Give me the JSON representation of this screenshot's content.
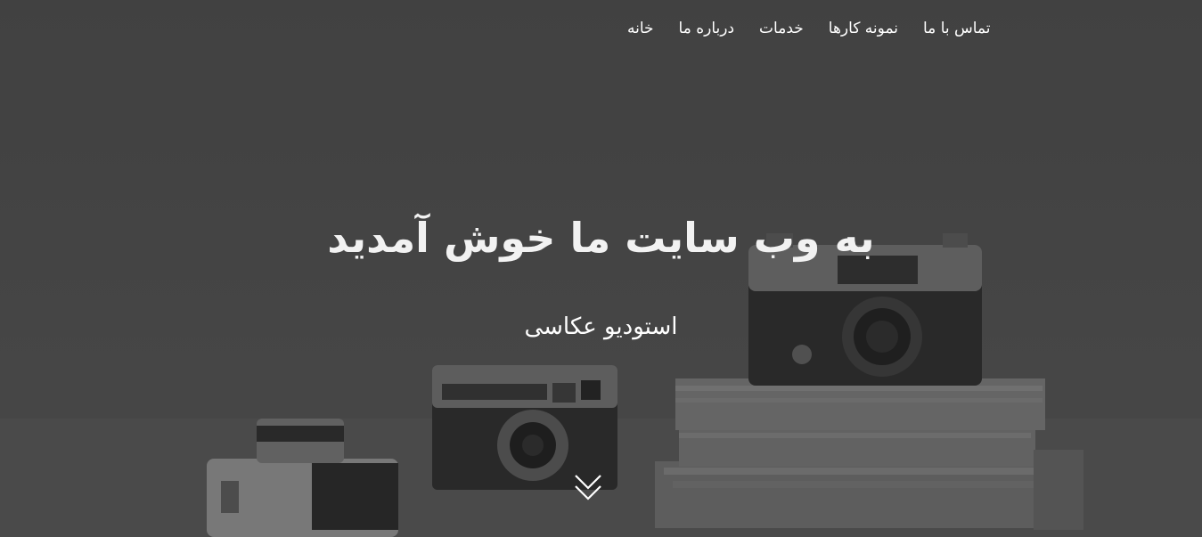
{
  "nav": {
    "items": [
      {
        "label": "خانه"
      },
      {
        "label": "درباره ما"
      },
      {
        "label": "خدمات"
      },
      {
        "label": "نمونه کارها"
      },
      {
        "label": "تماس با ما"
      }
    ]
  },
  "hero": {
    "title": "به وب سایت ما خوش آمدید",
    "subtitle": "استودیو عکاسی",
    "background": "cameras-on-books-photo",
    "scroll_icon": "double-chevron-down-icon"
  },
  "colors": {
    "overlay": "#4a4a4a",
    "text": "#ffffff"
  }
}
